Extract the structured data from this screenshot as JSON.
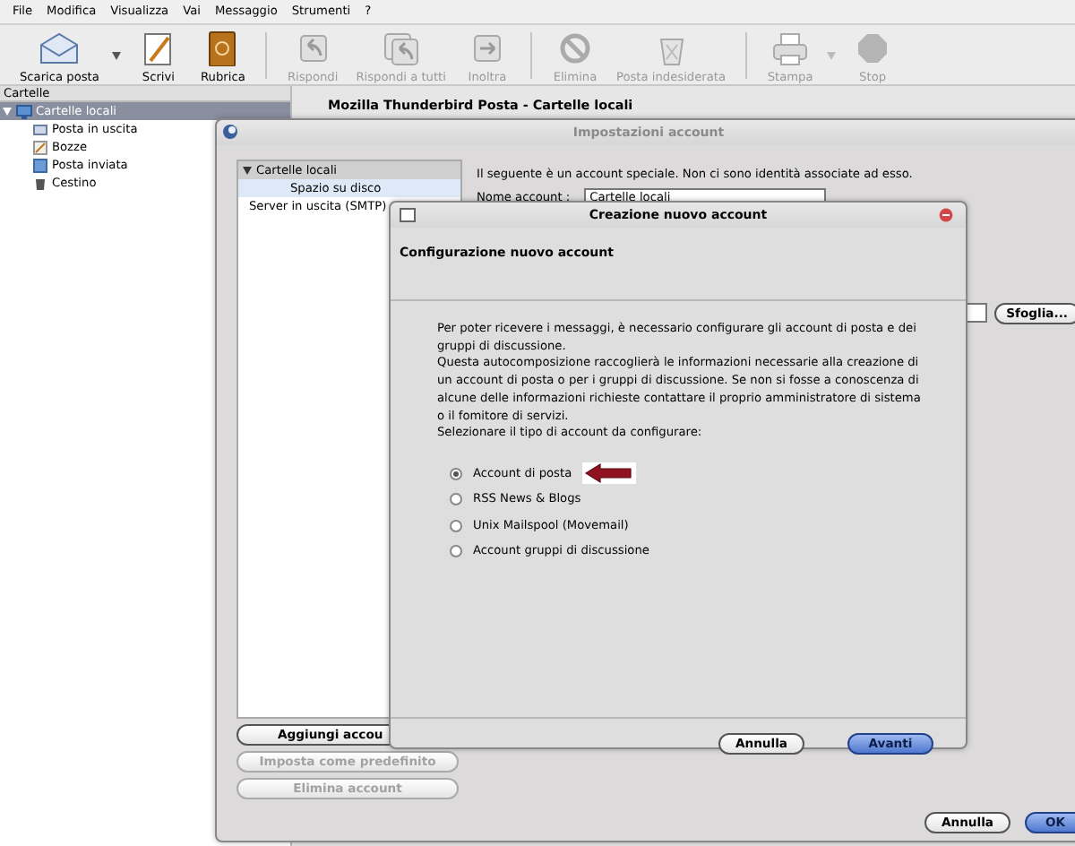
{
  "menu": [
    "File",
    "Modifica",
    "Visualizza",
    "Vai",
    "Messaggio",
    "Strumenti",
    "?"
  ],
  "toolbar": [
    {
      "label": "Scarica posta",
      "disabled": false,
      "dropdown": true,
      "separator_after": false
    },
    {
      "label": "Scrivi",
      "disabled": false,
      "dropdown": false,
      "separator_after": false
    },
    {
      "label": "Rubrica",
      "disabled": false,
      "dropdown": false,
      "separator_after": true
    },
    {
      "label": "Rispondi",
      "disabled": true,
      "dropdown": false,
      "separator_after": false
    },
    {
      "label": "Rispondi a tutti",
      "disabled": true,
      "dropdown": false,
      "separator_after": false
    },
    {
      "label": "Inoltra",
      "disabled": true,
      "dropdown": false,
      "separator_after": true
    },
    {
      "label": "Elimina",
      "disabled": true,
      "dropdown": false,
      "separator_after": false
    },
    {
      "label": "Posta indesiderata",
      "disabled": true,
      "dropdown": false,
      "separator_after": true
    },
    {
      "label": "Stampa",
      "disabled": true,
      "dropdown": true,
      "separator_after": false
    },
    {
      "label": "Stop",
      "disabled": true,
      "dropdown": false,
      "separator_after": false
    }
  ],
  "folder_pane": {
    "header": "Cartelle",
    "tree": [
      {
        "label": "Cartelle locali",
        "expanded": true,
        "selected": true,
        "children": [
          {
            "label": "Posta in uscita",
            "selected": false
          },
          {
            "label": "Bozze",
            "selected": false
          },
          {
            "label": "Posta inviata",
            "selected": false
          },
          {
            "label": "Cestino",
            "selected": false
          }
        ]
      }
    ]
  },
  "main_title": "Mozilla Thunderbird Posta - Cartelle locali",
  "account_settings": {
    "title": "Impostazioni account",
    "tree": [
      {
        "label": "Cartelle locali",
        "expanded": true,
        "selected": false,
        "children": [
          {
            "label": "Spazio su disco",
            "selected": true
          }
        ]
      },
      {
        "label": "Server in uscita (SMTP)",
        "selected": false
      }
    ],
    "notice": "Il seguente è un account speciale. Non ci sono identità associate ad esso.",
    "account_name_label": "Nome account :",
    "account_name_value": "Cartelle locali",
    "browse_button": "Sfoglia...",
    "side_buttons": [
      {
        "label": "Aggiungi accou",
        "disabled": false
      },
      {
        "label": "Imposta come predefinito",
        "disabled": true
      },
      {
        "label": "Elimina account",
        "disabled": true
      }
    ],
    "buttons": [
      {
        "label": "Annulla",
        "default": false
      },
      {
        "label": "OK",
        "default": true
      }
    ]
  },
  "wizard": {
    "title": "Creazione nuovo account",
    "heading": "Configurazione nuovo account",
    "paragraphs": [
      "Per poter ricevere i messaggi, è necessario configurare gli account di posta e dei gruppi di discussione.",
      "Questa autocomposizione raccoglierà le informazioni necessarie alla creazione di un account di posta o per i gruppi di discussione. Se non si fosse a conoscenza di alcune delle informazioni richieste contattare il proprio amministratore di sistema o il fomitore di servizi.",
      "Selezionare il tipo di account da configurare:"
    ],
    "options": [
      {
        "label": "Account di posta",
        "selected": true,
        "marked": true
      },
      {
        "label": "RSS News & Blogs",
        "selected": false,
        "marked": false
      },
      {
        "label": "Unix Mailspool (Movemail)",
        "selected": false,
        "marked": false
      },
      {
        "label": "Account gruppi di discussione",
        "selected": false,
        "marked": false
      }
    ],
    "buttons": [
      {
        "label": "Annulla",
        "default": false
      },
      {
        "label": "Avanti",
        "default": true
      }
    ]
  }
}
